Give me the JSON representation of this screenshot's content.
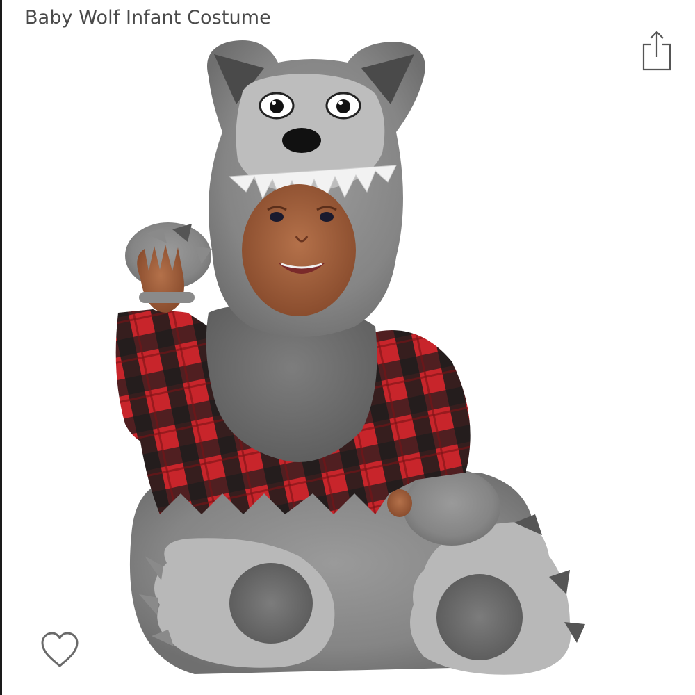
{
  "product": {
    "title": "Baby Wolf Infant Costume"
  },
  "icons": {
    "share": "share-icon",
    "wishlist": "heart-outline-icon"
  },
  "colors": {
    "title_text": "#4a4a4a",
    "icon_stroke": "#555555",
    "heart_stroke": "#6a6a6a",
    "fur_gray": "#8a8a8a",
    "plaid_red": "#c8252b",
    "plaid_black": "#1c1c1c",
    "skin": "#9a5a38"
  }
}
